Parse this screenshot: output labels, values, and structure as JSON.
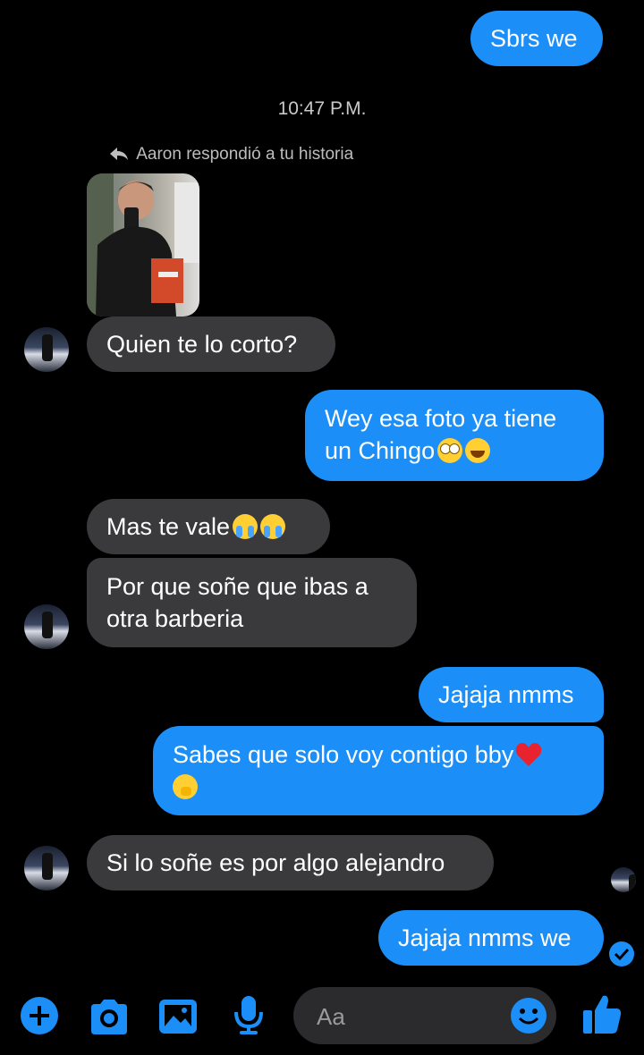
{
  "messages": {
    "m1": "Sbrs we",
    "time": "10:47 P.M.",
    "reply_note": "Aaron respondió a tu historia",
    "m2": "Quien te lo corto?",
    "m3_line1": "Wey esa foto ya tiene",
    "m3_line2": "un Chingo",
    "m4": "Mas te vale",
    "m5_line1": "Por que soñe que ibas a",
    "m5_line2": "otra barberia",
    "m6": "Jajaja nmms",
    "m7": "Sabes que solo voy contigo bby",
    "m8": "Si lo soñe es por algo alejandro",
    "m9": "Jajaja nmms we"
  },
  "composer": {
    "placeholder": "Aa",
    "icons": [
      "plus-icon",
      "camera-icon",
      "image-icon",
      "microphone-icon",
      "emoji-icon",
      "thumbs-up-icon"
    ]
  },
  "colors": {
    "accent": "#1b8ef8",
    "incoming": "#3a3a3c",
    "background": "#000000"
  }
}
